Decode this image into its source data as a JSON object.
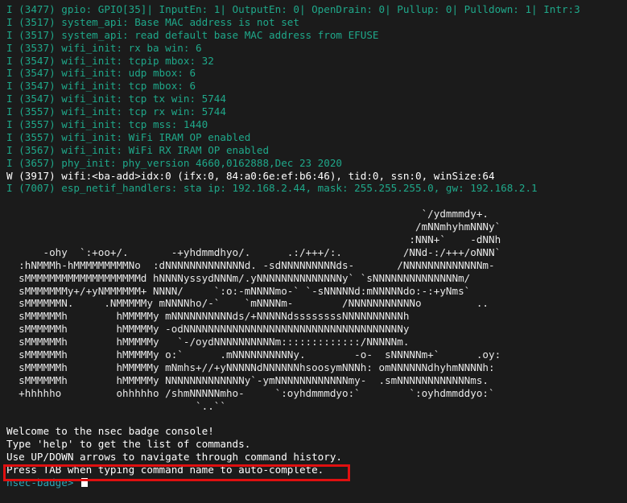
{
  "log_lines": [
    {
      "text": "I (3477) gpio: GPIO[35]| InputEn: 1| OutputEn: 0| OpenDrain: 0| Pullup: 0| Pulldown: 1| Intr:3",
      "level": "info"
    },
    {
      "text": "I (3517) system_api: Base MAC address is not set",
      "level": "info"
    },
    {
      "text": "I (3517) system_api: read default base MAC address from EFUSE",
      "level": "info"
    },
    {
      "text": "I (3537) wifi_init: rx ba win: 6",
      "level": "info"
    },
    {
      "text": "I (3547) wifi_init: tcpip mbox: 32",
      "level": "info"
    },
    {
      "text": "I (3547) wifi_init: udp mbox: 6",
      "level": "info"
    },
    {
      "text": "I (3547) wifi_init: tcp mbox: 6",
      "level": "info"
    },
    {
      "text": "I (3547) wifi_init: tcp tx win: 5744",
      "level": "info"
    },
    {
      "text": "I (3557) wifi_init: tcp rx win: 5744",
      "level": "info"
    },
    {
      "text": "I (3557) wifi_init: tcp mss: 1440",
      "level": "info"
    },
    {
      "text": "I (3557) wifi_init: WiFi IRAM OP enabled",
      "level": "info"
    },
    {
      "text": "I (3567) wifi_init: WiFi RX IRAM OP enabled",
      "level": "info"
    },
    {
      "text": "I (3657) phy_init: phy_version 4660,0162888,Dec 23 2020",
      "level": "info"
    },
    {
      "text": "W (3917) wifi:<ba-add>idx:0 (ifx:0, 84:a0:6e:ef:b6:46), tid:0, ssn:0, winSize:64",
      "level": "warn"
    },
    {
      "text": "I (7007) esp_netif_handlers: sta ip: 192.168.2.44, mask: 255.255.255.0, gw: 192.168.2.1",
      "level": "info"
    }
  ],
  "ascii_art": [
    "",
    "                                                                    `/ydmmmdy+.",
    "                                                                   /mNNmhyhmNNNy`",
    "                                                                  :NNN+`    -dNNh",
    "      -ohy  `:+oo+/.       -+yhdmmdhyo/.      .:/+++/:.          /NNd-:/+++/oNNN`",
    "  :hNMMMh-hMMMMMMMMMNo  :dNNNNNNNNNNNNNd. -sdNNNNNNNNNds-       /NNNNNNNNNNNNNm-",
    "  sMMMMMMMMMMMMMMMMMMMd hNNNNyssydNNNm/.yNNNNNNNNNNNNNNy` `sNNNNNNNNNNNNNNm/",
    "  sMMMMMMMy+/+yNMMMMMM+ NNNN/     `:o:-mNNNNmo-` `-sNNNNNd:mNNNNNdo:-:+yNms`",
    "  sMMMMMMN.     .NMMMMMy mNNNNho/-`    `mNNNNm-        /NNNNNNNNNNNo         ..",
    "  sMMMMMMh        hMMMMMy mNNNNNNNNNNds/+NNNNNdssssssssNNNNNNNNNNh",
    "  sMMMMMMh        hMMMMMy -odNNNNNNNNNNNNNNNNNNNNNNNNNNNNNNNNNNNNy",
    "  sMMMMMMh        hMMMMMy   `-/oydNNNNNNNNNNm:::::::::::::/NNNNNm.",
    "  sMMMMMMh        hMMMMMy o:`      .mNNNNNNNNNNy.        -o-  sNNNNNm+`      .oy:",
    "  sMMMMMMh        hMMMMMy mNmhs+//+yNNNNNdNNNNNNhsoosymNNNh: omNNNNNNdhyhmNNNNh:",
    "  sMMMMMMh        hMMMMMy NNNNNNNNNNNNNy`-ymNNNNNNNNNNNNmy-  .smNNNNNNNNNNNNms.",
    "  +hhhhho         ohhhhho /shmNNNNNmho-     `:oyhdmmmdyo:`        `:oyhdmmddyo:`",
    "                               `..``",
    ""
  ],
  "welcome_lines": [
    "Welcome to the nsec badge console!",
    "Type 'help' to get the list of commands.",
    "Use UP/DOWN arrows to navigate through command history.",
    "Press TAB when typing command name to auto-complete."
  ],
  "prompt": "nsec-badge> ",
  "colors": {
    "background": "#1b1b1b",
    "info_text": "#1fa88a",
    "warn_text": "#ffffff",
    "prompt_text": "#2aa6b6",
    "highlight_border": "#e01010"
  }
}
